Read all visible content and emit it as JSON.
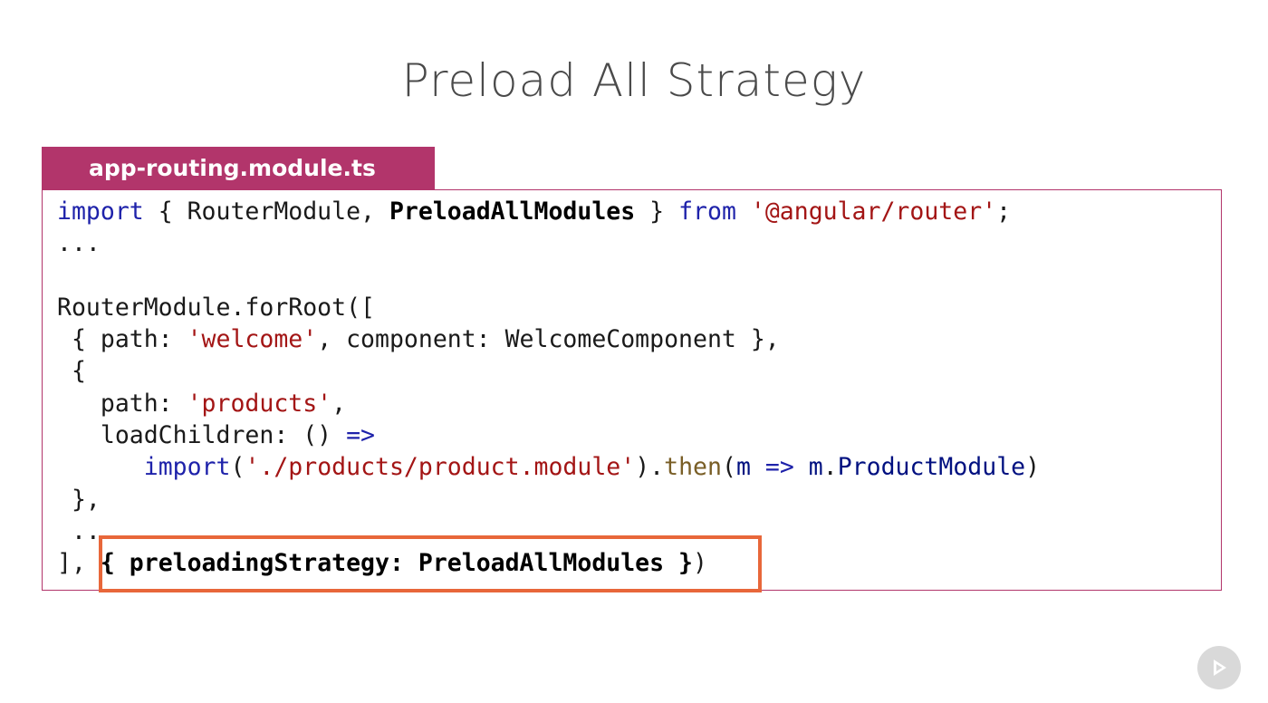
{
  "slide": {
    "title": "Preload All Strategy"
  },
  "file_tab": {
    "label": "app-routing.module.ts"
  },
  "code": {
    "line1": {
      "kw_import": "import",
      "p1": " { RouterModule, ",
      "bold": "PreloadAllModules",
      "p2": " } ",
      "kw_from": "from",
      "p3": " ",
      "str": "'@angular/router'",
      "p4": ";"
    },
    "line2": "...",
    "line3": "",
    "line4": "RouterModule.forRoot([",
    "line5": {
      "p1": " { path: ",
      "str": "'welcome'",
      "p2": ", component: WelcomeComponent },"
    },
    "line6": " {",
    "line7": {
      "p1": "   path: ",
      "str": "'products'",
      "p2": ","
    },
    "line8": {
      "p1": "   loadChildren: () ",
      "arrow": "=>"
    },
    "line9": {
      "p0": "      ",
      "kw_import": "import",
      "p1": "(",
      "str": "'./products/product.module'",
      "p2": ").",
      "fn_then": "then",
      "p3": "(",
      "id_m": "m",
      "p4": " ",
      "arrow": "=>",
      "p5": " ",
      "id_m2": "m",
      "p6": ".",
      "id_module": "ProductModule",
      "p7": ")"
    },
    "line10": " },",
    "line11": " ...",
    "line12": {
      "p1": "], ",
      "bold": "{ preloadingStrategy: PreloadAllModules }",
      "p2": ")"
    }
  },
  "colors": {
    "accent": "#b2356b",
    "highlight": "#e8673a",
    "keyword": "#1e22aa",
    "string": "#a31515"
  },
  "icons": {
    "player": "play-icon"
  }
}
